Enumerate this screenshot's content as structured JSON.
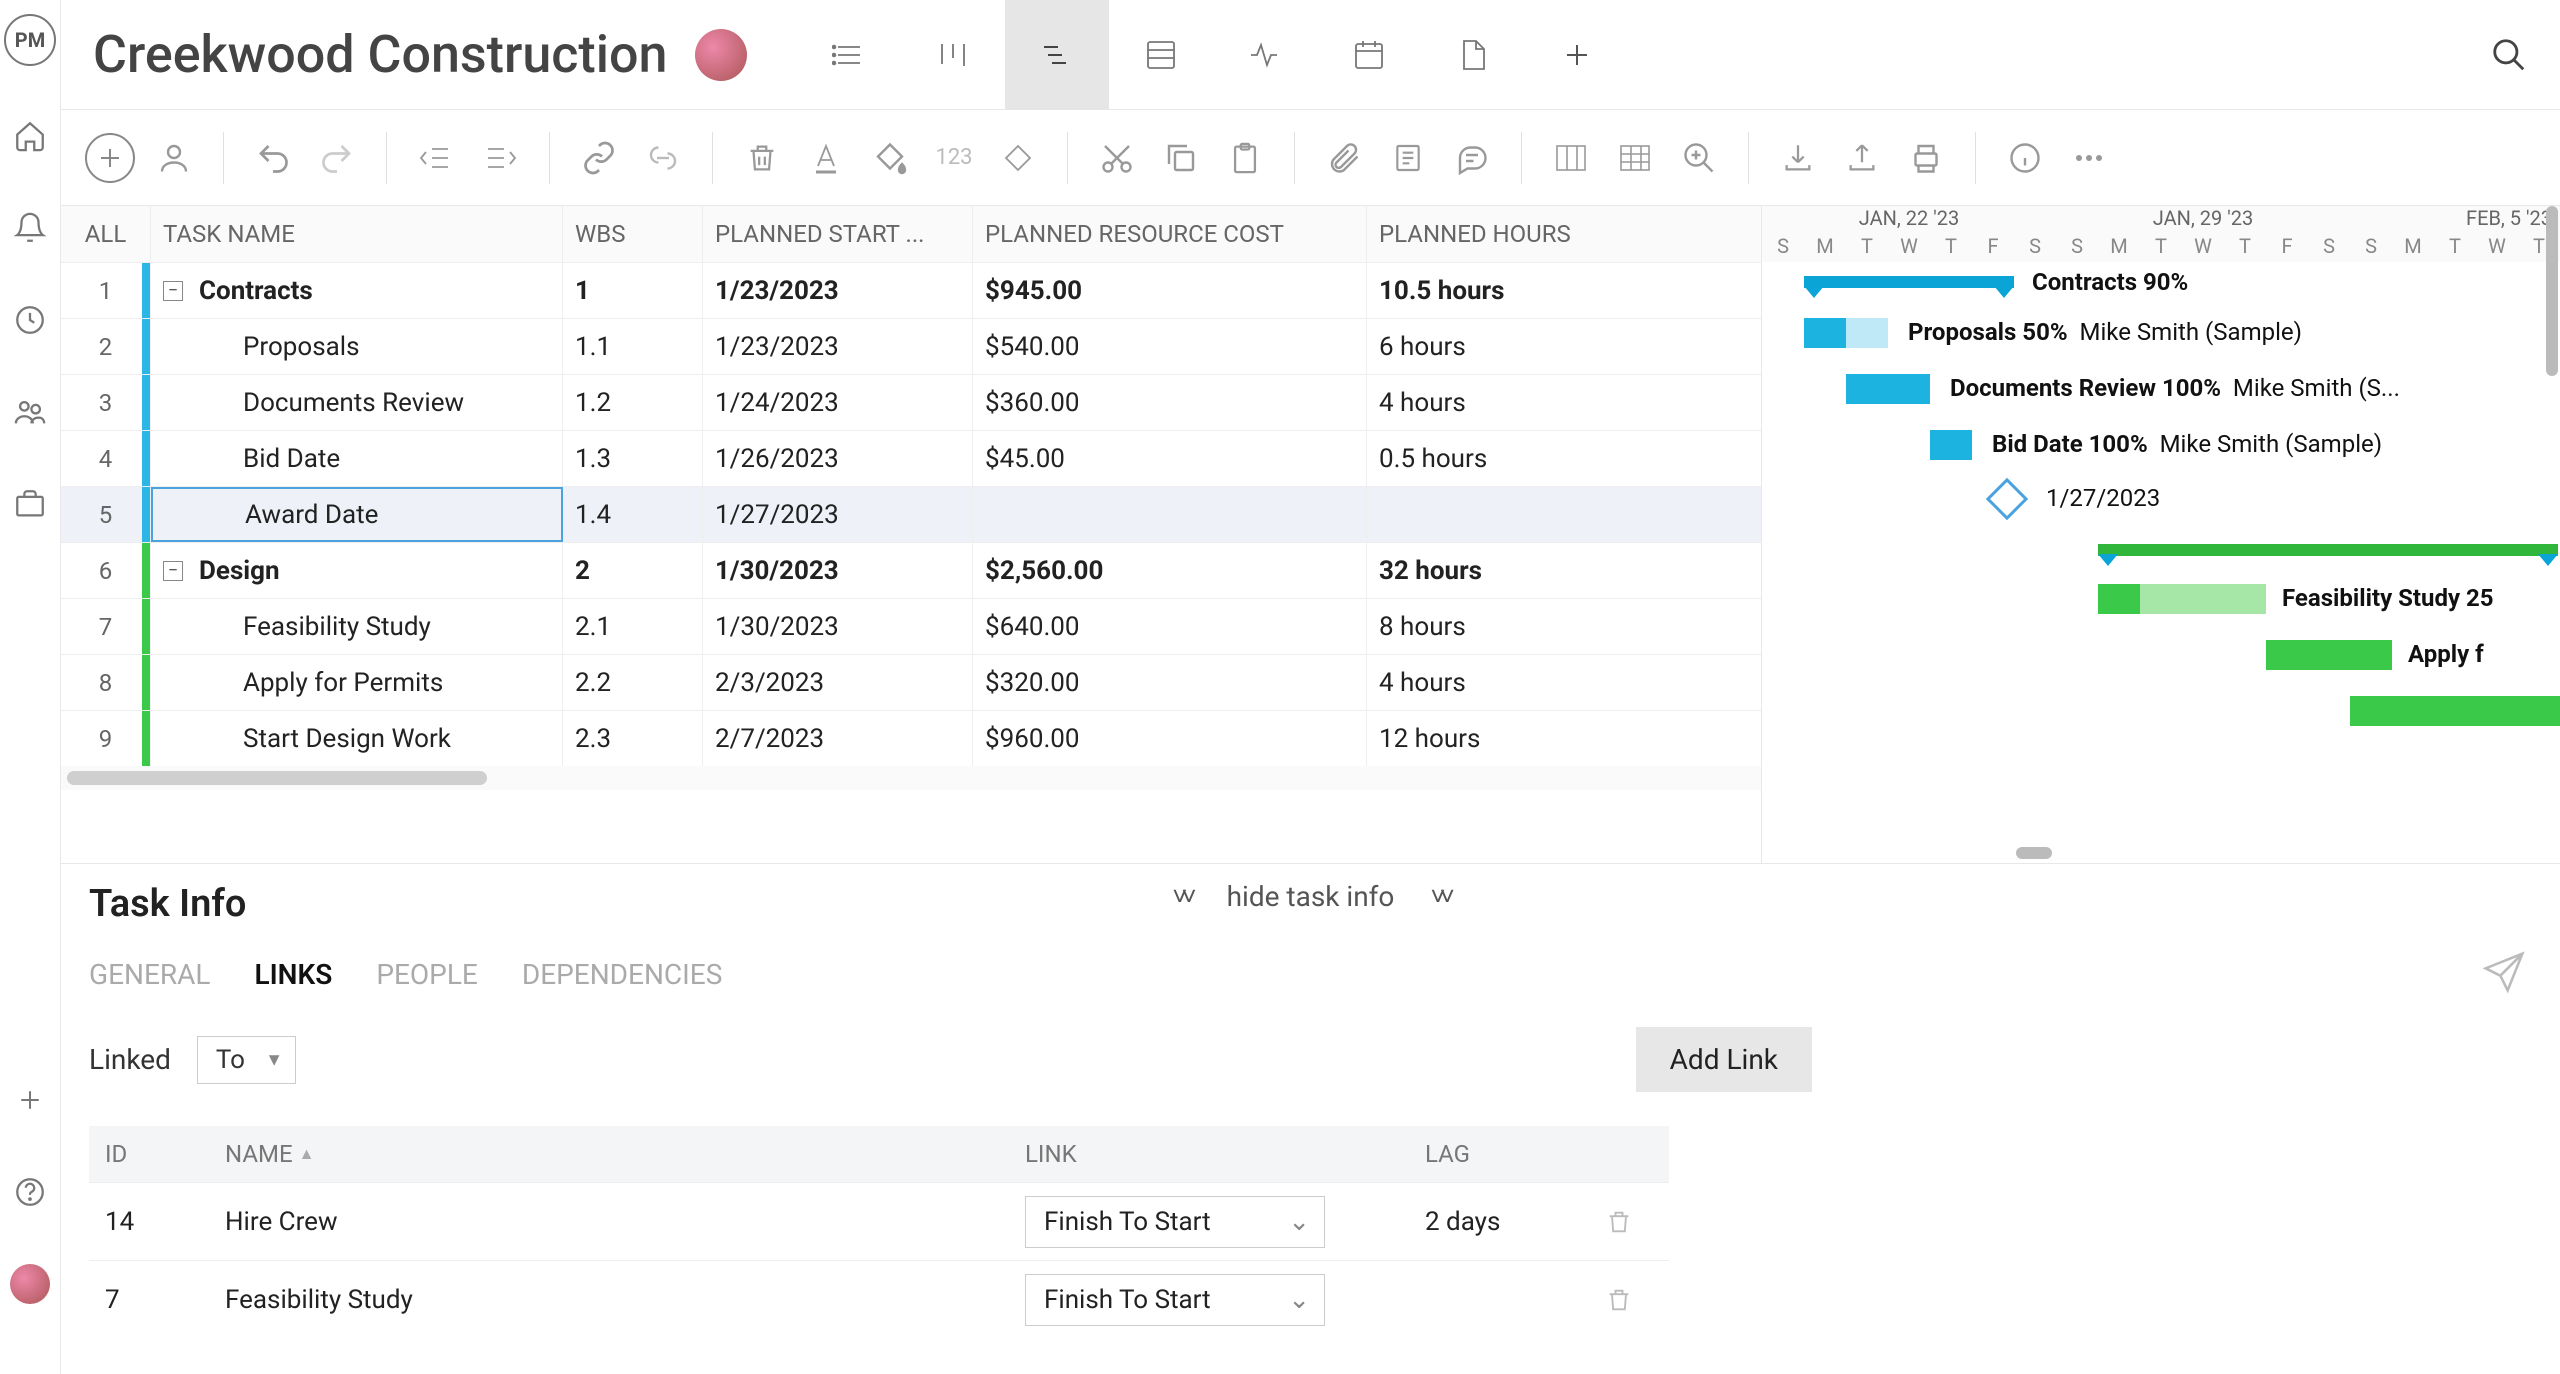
{
  "project_title": "Creekwood Construction",
  "grid": {
    "columns": {
      "all": "ALL",
      "name": "TASK NAME",
      "wbs": "WBS",
      "start": "PLANNED START ...",
      "cost": "PLANNED RESOURCE COST",
      "hours": "PLANNED HOURS"
    },
    "rows": [
      {
        "idx": "1",
        "name": "Contracts",
        "wbs": "1",
        "start": "1/23/2023",
        "cost": "$945.00",
        "hours": "10.5 hours",
        "level": 0,
        "bold": true,
        "color": "#2bb6e6"
      },
      {
        "idx": "2",
        "name": "Proposals",
        "wbs": "1.1",
        "start": "1/23/2023",
        "cost": "$540.00",
        "hours": "6 hours",
        "level": 1,
        "color": "#2bb6e6"
      },
      {
        "idx": "3",
        "name": "Documents Review",
        "wbs": "1.2",
        "start": "1/24/2023",
        "cost": "$360.00",
        "hours": "4 hours",
        "level": 1,
        "color": "#2bb6e6"
      },
      {
        "idx": "4",
        "name": "Bid Date",
        "wbs": "1.3",
        "start": "1/26/2023",
        "cost": "$45.00",
        "hours": "0.5 hours",
        "level": 1,
        "color": "#2bb6e6"
      },
      {
        "idx": "5",
        "name": "Award Date",
        "wbs": "1.4",
        "start": "1/27/2023",
        "cost": "",
        "hours": "",
        "level": 1,
        "color": "#2bb6e6",
        "selected": true
      },
      {
        "idx": "6",
        "name": "Design",
        "wbs": "2",
        "start": "1/30/2023",
        "cost": "$2,560.00",
        "hours": "32 hours",
        "level": 0,
        "bold": true,
        "color": "#3bc94a"
      },
      {
        "idx": "7",
        "name": "Feasibility Study",
        "wbs": "2.1",
        "start": "1/30/2023",
        "cost": "$640.00",
        "hours": "8 hours",
        "level": 1,
        "color": "#3bc94a"
      },
      {
        "idx": "8",
        "name": "Apply for Permits",
        "wbs": "2.2",
        "start": "2/3/2023",
        "cost": "$320.00",
        "hours": "4 hours",
        "level": 1,
        "color": "#3bc94a"
      },
      {
        "idx": "9",
        "name": "Start Design Work",
        "wbs": "2.3",
        "start": "2/7/2023",
        "cost": "$960.00",
        "hours": "12 hours",
        "level": 1,
        "color": "#3bc94a"
      }
    ]
  },
  "gantt": {
    "weeks": [
      "JAN, 22 '23",
      "JAN, 29 '23",
      "FEB, 5 '23"
    ],
    "days": [
      "S",
      "M",
      "T",
      "W",
      "T",
      "F",
      "S",
      "S",
      "M",
      "T",
      "W",
      "T",
      "F",
      "S",
      "S",
      "M",
      "T",
      "W",
      "T"
    ],
    "labels": {
      "contracts": "Contracts  90%",
      "proposals": "Proposals  50%",
      "proposals_asg": "Mike Smith (Sample)",
      "docs": "Documents Review  100%",
      "docs_asg": "Mike Smith (S...",
      "bid": "Bid Date  100%",
      "bid_asg": "Mike Smith (Sample)",
      "award_date": "1/27/2023",
      "feasibility": "Feasibility Study  25",
      "apply": "Apply f"
    }
  },
  "task_info": {
    "title": "Task Info",
    "hide_label": "hide task info",
    "tabs": [
      "GENERAL",
      "LINKS",
      "PEOPLE",
      "DEPENDENCIES"
    ],
    "active_tab": "LINKS",
    "linked_label": "Linked",
    "linked_dir": "To",
    "add_link": "Add Link",
    "columns": {
      "id": "ID",
      "name": "NAME",
      "link": "LINK",
      "lag": "LAG"
    },
    "rows": [
      {
        "id": "14",
        "name": "Hire Crew",
        "link": "Finish To Start",
        "lag": "2 days"
      },
      {
        "id": "7",
        "name": "Feasibility Study",
        "link": "Finish To Start",
        "lag": ""
      }
    ]
  },
  "toolbar_num": "123",
  "logo_text": "PM"
}
